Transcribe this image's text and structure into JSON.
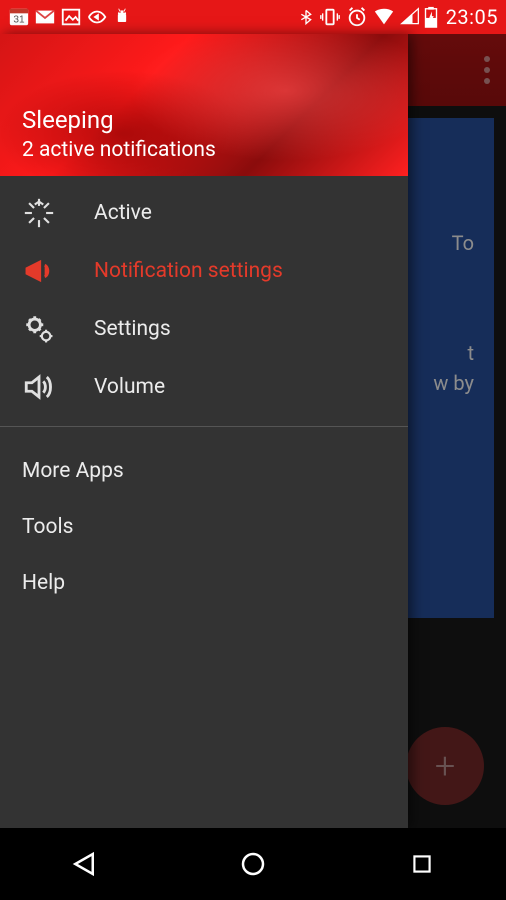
{
  "statusbar": {
    "calendar_day": "31",
    "time": "23:05"
  },
  "drawer": {
    "header": {
      "title": "Sleeping",
      "subtitle": "2 active notifications"
    },
    "items": [
      {
        "label": "Active",
        "icon": "burst-icon",
        "selected": false
      },
      {
        "label": "Notification settings",
        "icon": "megaphone-icon",
        "selected": true
      },
      {
        "label": "Settings",
        "icon": "gears-icon",
        "selected": false
      },
      {
        "label": "Volume",
        "icon": "volume-icon",
        "selected": false
      }
    ],
    "secondary": [
      {
        "label": "More Apps"
      },
      {
        "label": "Tools"
      },
      {
        "label": "Help"
      }
    ]
  },
  "main": {
    "card_text_fragments": [
      "To",
      "t",
      "w by"
    ]
  },
  "fab": {
    "label": "+"
  },
  "colors": {
    "accent": "#e61717",
    "drawer_bg": "#333333",
    "selected": "#e43a2a"
  }
}
